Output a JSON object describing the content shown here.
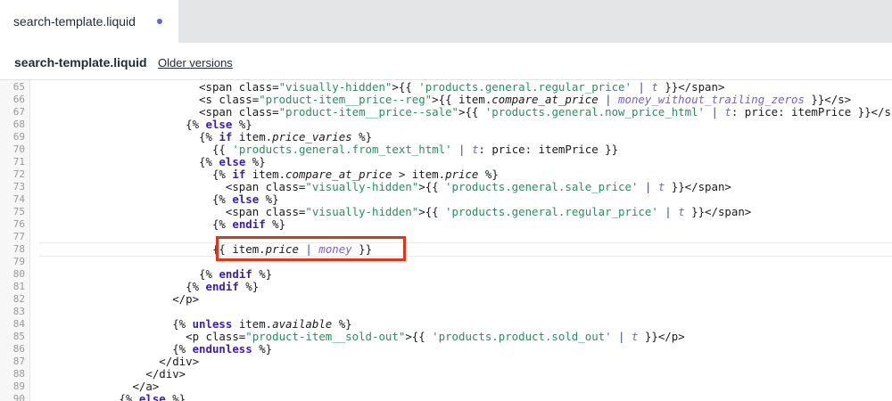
{
  "tab": {
    "label": "search-template.liquid",
    "unsaved_dot": "#5c6ac4"
  },
  "header": {
    "title": "search-template.liquid",
    "older_versions": "Older versions"
  },
  "colors": {
    "highlight_box": "#de3618",
    "string": "#219161",
    "keyword": "#3c1eaf",
    "filter": "#7b5bcf"
  },
  "editor": {
    "lines": [
      {
        "n": "65",
        "indent": 24,
        "tokens": [
          {
            "t": "<span class=",
            "c": ""
          },
          {
            "t": "\"visually-hidden\"",
            "c": "t-str"
          },
          {
            "t": ">{{ ",
            "c": ""
          },
          {
            "t": "'products.general.regular_price'",
            "c": "t-str"
          },
          {
            "t": " | ",
            "c": "t-pipe"
          },
          {
            "t": "t",
            "c": "t-filter"
          },
          {
            "t": " }}</span>",
            "c": ""
          }
        ]
      },
      {
        "n": "66",
        "indent": 24,
        "tokens": [
          {
            "t": "<s class=",
            "c": ""
          },
          {
            "t": "\"product-item__price--reg\"",
            "c": "t-str"
          },
          {
            "t": ">{{ item.",
            "c": ""
          },
          {
            "t": "compare_at_price",
            "c": "t-it"
          },
          {
            "t": " | ",
            "c": "t-pipe"
          },
          {
            "t": "money_without_trailing_zeros",
            "c": "t-filter"
          },
          {
            "t": " }}</s>",
            "c": ""
          }
        ]
      },
      {
        "n": "67",
        "indent": 24,
        "tokens": [
          {
            "t": "<span class=",
            "c": ""
          },
          {
            "t": "\"product-item__price--sale\"",
            "c": "t-str"
          },
          {
            "t": ">{{ ",
            "c": ""
          },
          {
            "t": "'products.general.now_price_html'",
            "c": "t-str"
          },
          {
            "t": " | ",
            "c": "t-pipe"
          },
          {
            "t": "t",
            "c": "t-filter"
          },
          {
            "t": ": price: itemPrice }}</span>",
            "c": ""
          }
        ]
      },
      {
        "n": "68",
        "indent": 22,
        "tokens": [
          {
            "t": "{% ",
            "c": ""
          },
          {
            "t": "else",
            "c": "t-kw"
          },
          {
            "t": " %}",
            "c": ""
          }
        ]
      },
      {
        "n": "69",
        "indent": 24,
        "tokens": [
          {
            "t": "{% ",
            "c": ""
          },
          {
            "t": "if",
            "c": "t-kw"
          },
          {
            "t": " item.",
            "c": ""
          },
          {
            "t": "price_varies",
            "c": "t-it"
          },
          {
            "t": " %}",
            "c": ""
          }
        ]
      },
      {
        "n": "70",
        "indent": 26,
        "tokens": [
          {
            "t": "{{ ",
            "c": ""
          },
          {
            "t": "'products.general.from_text_html'",
            "c": "t-str"
          },
          {
            "t": " | ",
            "c": "t-pipe"
          },
          {
            "t": "t",
            "c": "t-filter"
          },
          {
            "t": ": price: itemPrice }}",
            "c": ""
          }
        ]
      },
      {
        "n": "71",
        "indent": 24,
        "tokens": [
          {
            "t": "{% ",
            "c": ""
          },
          {
            "t": "else",
            "c": "t-kw"
          },
          {
            "t": " %}",
            "c": ""
          }
        ]
      },
      {
        "n": "72",
        "indent": 26,
        "tokens": [
          {
            "t": "{% ",
            "c": ""
          },
          {
            "t": "if",
            "c": "t-kw"
          },
          {
            "t": " item.",
            "c": ""
          },
          {
            "t": "compare_at_price",
            "c": "t-it"
          },
          {
            "t": " > item.",
            "c": ""
          },
          {
            "t": "price",
            "c": "t-it"
          },
          {
            "t": " %}",
            "c": ""
          }
        ]
      },
      {
        "n": "73",
        "indent": 28,
        "tokens": [
          {
            "t": "<span class=",
            "c": ""
          },
          {
            "t": "\"visually-hidden\"",
            "c": "t-str"
          },
          {
            "t": ">{{ ",
            "c": ""
          },
          {
            "t": "'products.general.sale_price'",
            "c": "t-str"
          },
          {
            "t": " | ",
            "c": "t-pipe"
          },
          {
            "t": "t",
            "c": "t-filter"
          },
          {
            "t": " }}</span>",
            "c": ""
          }
        ]
      },
      {
        "n": "74",
        "indent": 26,
        "tokens": [
          {
            "t": "{% ",
            "c": ""
          },
          {
            "t": "else",
            "c": "t-kw"
          },
          {
            "t": " %}",
            "c": ""
          }
        ]
      },
      {
        "n": "75",
        "indent": 28,
        "tokens": [
          {
            "t": "<span class=",
            "c": ""
          },
          {
            "t": "\"visually-hidden\"",
            "c": "t-str"
          },
          {
            "t": ">{{ ",
            "c": ""
          },
          {
            "t": "'products.general.regular_price'",
            "c": "t-str"
          },
          {
            "t": " | ",
            "c": "t-pipe"
          },
          {
            "t": "t",
            "c": "t-filter"
          },
          {
            "t": " }}</span>",
            "c": ""
          }
        ]
      },
      {
        "n": "76",
        "indent": 26,
        "tokens": [
          {
            "t": "{% ",
            "c": ""
          },
          {
            "t": "endif",
            "c": "t-kw"
          },
          {
            "t": " %}",
            "c": ""
          }
        ]
      },
      {
        "n": "77",
        "indent": 0,
        "tokens": []
      },
      {
        "n": "78",
        "indent": 26,
        "tokens": [
          {
            "t": "{{ item.",
            "c": ""
          },
          {
            "t": "price",
            "c": "t-it"
          },
          {
            "t": " | ",
            "c": "t-pipe"
          },
          {
            "t": "money",
            "c": "t-filter"
          },
          {
            "t": " }}",
            "c": ""
          }
        ]
      },
      {
        "n": "79",
        "indent": 0,
        "tokens": []
      },
      {
        "n": "80",
        "indent": 24,
        "tokens": [
          {
            "t": "{% ",
            "c": ""
          },
          {
            "t": "endif",
            "c": "t-kw"
          },
          {
            "t": " %}",
            "c": ""
          }
        ]
      },
      {
        "n": "81",
        "indent": 22,
        "tokens": [
          {
            "t": "{% ",
            "c": ""
          },
          {
            "t": "endif",
            "c": "t-kw"
          },
          {
            "t": " %}",
            "c": ""
          }
        ]
      },
      {
        "n": "82",
        "indent": 20,
        "tokens": [
          {
            "t": "</p>",
            "c": ""
          }
        ]
      },
      {
        "n": "83",
        "indent": 0,
        "tokens": []
      },
      {
        "n": "84",
        "indent": 20,
        "tokens": [
          {
            "t": "{% ",
            "c": ""
          },
          {
            "t": "unless",
            "c": "t-kw"
          },
          {
            "t": " item.",
            "c": ""
          },
          {
            "t": "available",
            "c": "t-it"
          },
          {
            "t": " %}",
            "c": ""
          }
        ]
      },
      {
        "n": "85",
        "indent": 22,
        "tokens": [
          {
            "t": "<p class=",
            "c": ""
          },
          {
            "t": "\"product-item__sold-out\"",
            "c": "t-str"
          },
          {
            "t": ">{{ ",
            "c": ""
          },
          {
            "t": "'products.product.sold_out'",
            "c": "t-str"
          },
          {
            "t": " | ",
            "c": "t-pipe"
          },
          {
            "t": "t",
            "c": "t-filter"
          },
          {
            "t": " }}</p>",
            "c": ""
          }
        ]
      },
      {
        "n": "86",
        "indent": 20,
        "tokens": [
          {
            "t": "{% ",
            "c": ""
          },
          {
            "t": "endunless",
            "c": "t-kw"
          },
          {
            "t": " %}",
            "c": ""
          }
        ]
      },
      {
        "n": "87",
        "indent": 18,
        "tokens": [
          {
            "t": "</div>",
            "c": ""
          }
        ]
      },
      {
        "n": "88",
        "indent": 16,
        "tokens": [
          {
            "t": "</div>",
            "c": ""
          }
        ]
      },
      {
        "n": "89",
        "indent": 14,
        "tokens": [
          {
            "t": "</a>",
            "c": ""
          }
        ]
      },
      {
        "n": "90",
        "indent": 12,
        "tokens": [
          {
            "t": "{% ",
            "c": ""
          },
          {
            "t": "else",
            "c": "t-kw"
          },
          {
            "t": " %}",
            "c": ""
          }
        ]
      }
    ]
  }
}
